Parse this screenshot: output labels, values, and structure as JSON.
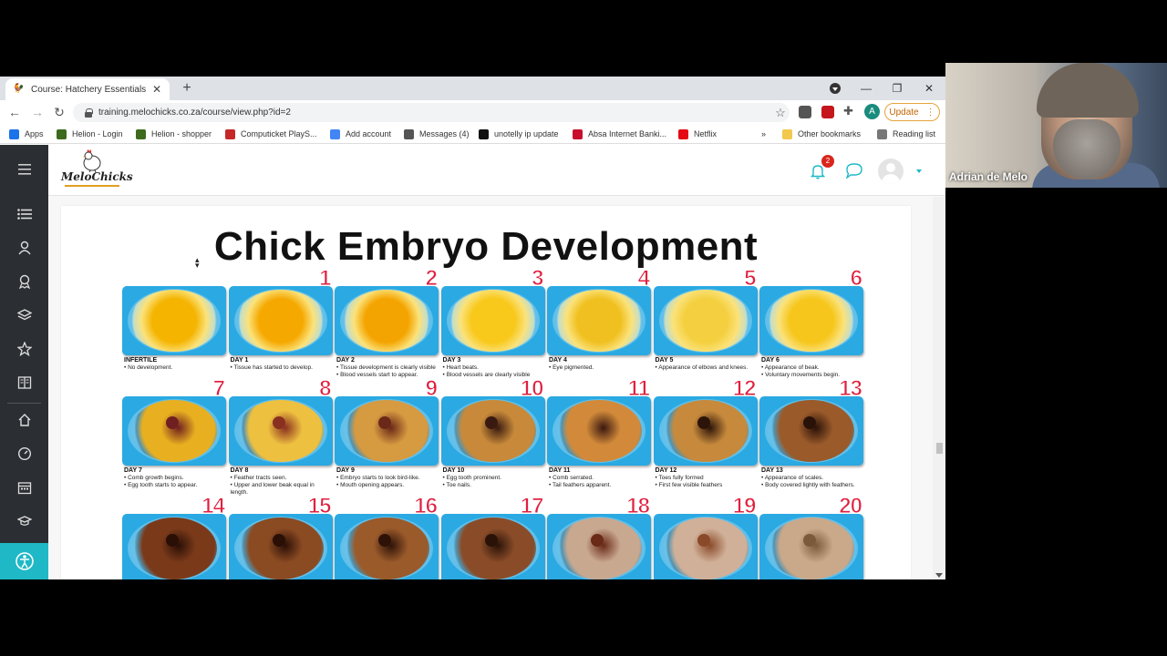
{
  "browser": {
    "tab_title": "Course: Hatchery Essentials",
    "url": "training.melochicks.co.za/course/view.php?id=2",
    "update_label": "Update",
    "avatar_letter": "A",
    "bookmarks": [
      {
        "label": "Apps",
        "color": "#1a73e8"
      },
      {
        "label": "Helion - Login",
        "color": "#3d6b1e"
      },
      {
        "label": "Helion - shopper",
        "color": "#3d6b1e"
      },
      {
        "label": "Computicket PlayS...",
        "color": "#c62828"
      },
      {
        "label": "Add account",
        "color": "#4285f4"
      },
      {
        "label": "Messages (4)",
        "color": "#555555"
      },
      {
        "label": "unotelly ip update",
        "color": "#111111"
      },
      {
        "label": "Absa Internet Banki...",
        "color": "#c8102e"
      },
      {
        "label": "Netflix",
        "color": "#e50914"
      }
    ],
    "overflow_label": "»",
    "other_bookmarks": "Other bookmarks",
    "reading_list": "Reading list"
  },
  "site": {
    "logo_text": "MeloChicks",
    "notification_count": "2",
    "accent": "#1fb8c6"
  },
  "slide": {
    "title": "Chick Embryo Development",
    "rows": [
      [
        {
          "num": "",
          "day": "INFERTILE",
          "desc": "• No development."
        },
        {
          "num": "1",
          "day": "DAY 1",
          "desc": "• Tissue has started to develop."
        },
        {
          "num": "2",
          "day": "DAY 2",
          "desc": "• Tissue development is clearly visible\n• Blood vessels start to appear."
        },
        {
          "num": "3",
          "day": "DAY 3",
          "desc": "• Heart beats.\n• Blood vessels are clearly visible"
        },
        {
          "num": "4",
          "day": "DAY 4",
          "desc": "• Eye pigmented."
        },
        {
          "num": "5",
          "day": "DAY 5",
          "desc": "• Appearance of elbows and knees."
        },
        {
          "num": "6",
          "day": "DAY 6",
          "desc": "• Appearance of beak.\n• Voluntary movements begin."
        }
      ],
      [
        {
          "num": "7",
          "day": "DAY 7",
          "desc": "• Comb growth begins.\n• Egg tooth starts to appear."
        },
        {
          "num": "8",
          "day": "DAY 8",
          "desc": "• Feather tracts seen.\n• Upper and lower beak equal in length."
        },
        {
          "num": "9",
          "day": "DAY 9",
          "desc": "• Embryo starts to look bird-like.\n• Mouth opening appears."
        },
        {
          "num": "10",
          "day": "DAY 10",
          "desc": "• Egg tooth prominent.\n• Toe nails."
        },
        {
          "num": "11",
          "day": "DAY 11",
          "desc": "• Comb serrated.\n• Tail feathers apparent."
        },
        {
          "num": "12",
          "day": "DAY 12",
          "desc": "• Toes fully formed\n• First few visible feathers"
        },
        {
          "num": "13",
          "day": "DAY 13",
          "desc": "• Appearance of scales.\n• Body covered lightly with feathers."
        }
      ],
      [
        {
          "num": "14",
          "day": "",
          "desc": ""
        },
        {
          "num": "15",
          "day": "",
          "desc": ""
        },
        {
          "num": "16",
          "day": "",
          "desc": ""
        },
        {
          "num": "17",
          "day": "",
          "desc": ""
        },
        {
          "num": "18",
          "day": "",
          "desc": ""
        },
        {
          "num": "19",
          "day": "",
          "desc": ""
        },
        {
          "num": "20",
          "day": "",
          "desc": ""
        }
      ]
    ]
  },
  "video": {
    "participant_name": "Adrian de Melo"
  }
}
